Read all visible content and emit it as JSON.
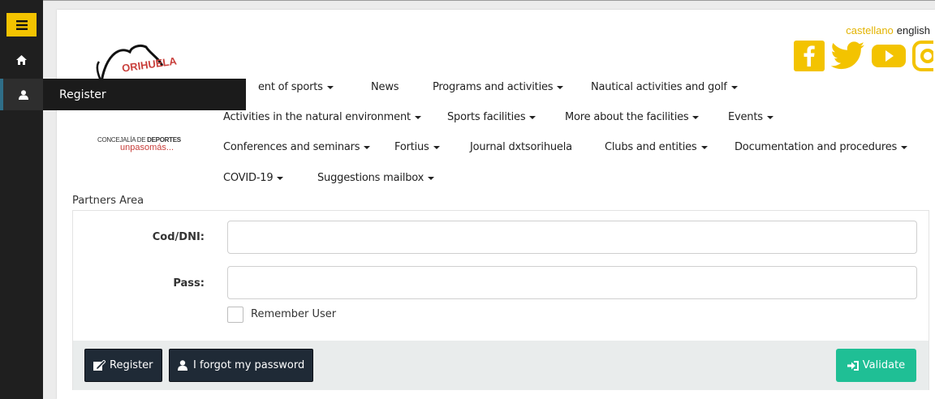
{
  "sidebar": {
    "menu_icon": "hamburger-icon",
    "home_icon": "home-icon",
    "user_icon": "user-icon",
    "register_label": "Register"
  },
  "header": {
    "logo_text_line1_a": "CONCEJALÍA DE ",
    "logo_text_line1_b": "DEPORTES",
    "logo_text_line2": "unpasomás...",
    "logo_word": "ORIHUELA",
    "lang_castellano": "castellano",
    "lang_english": "english",
    "social": [
      "facebook-icon",
      "twitter-icon",
      "youtube-icon",
      "instagram-icon"
    ]
  },
  "nav": {
    "items": [
      {
        "label": "ent of sports",
        "caret": true
      },
      {
        "label": "News",
        "caret": false
      },
      {
        "label": "Programs and activities",
        "caret": true
      },
      {
        "label": "Nautical activities and golf",
        "caret": true
      },
      {
        "label": "Activities in the natural environment",
        "caret": true
      },
      {
        "label": "Sports facilities",
        "caret": true
      },
      {
        "label": "More about the facilities",
        "caret": true
      },
      {
        "label": "Events",
        "caret": true
      },
      {
        "label": "Conferences and seminars",
        "caret": true
      },
      {
        "label": "Fortius",
        "caret": true
      },
      {
        "label": "Journal dxtsorihuela",
        "caret": false
      },
      {
        "label": "Clubs and entities",
        "caret": true
      },
      {
        "label": "Documentation and procedures",
        "caret": true
      },
      {
        "label": "COVID-19",
        "caret": true
      },
      {
        "label": "Suggestions mailbox",
        "caret": true
      }
    ]
  },
  "form": {
    "section_title": "Partners Area",
    "code_label": "Cod/DNI:",
    "code_value": "",
    "pass_label": "Pass:",
    "pass_value": "",
    "remember_label": "Remember User",
    "register_button": "Register",
    "forgot_button": "I forgot my password",
    "validate_button": "Validate"
  },
  "colors": {
    "accent_yellow": "#f3c300",
    "validate_green": "#1fbf95",
    "dark_button": "#1f2a36"
  }
}
